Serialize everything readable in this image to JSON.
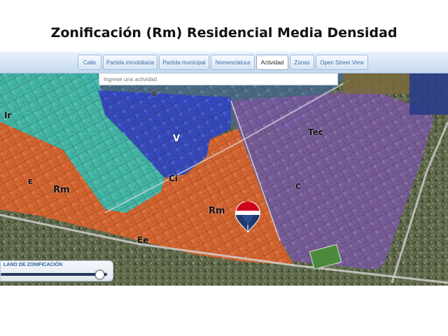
{
  "page": {
    "title": "Zonificación (Rm) Residencial Media Densidad"
  },
  "tabs": [
    {
      "label": "Calle",
      "active": false
    },
    {
      "label": "Partida inmobiliaria",
      "active": false
    },
    {
      "label": "Partida municipal",
      "active": false
    },
    {
      "label": "Nomenclatura",
      "active": false
    },
    {
      "label": "Actividad",
      "active": true
    },
    {
      "label": "Zonas",
      "active": false
    },
    {
      "label": "Open Street View",
      "active": false
    }
  ],
  "search": {
    "placeholder": "Ingrese una actividad",
    "value": ""
  },
  "map": {
    "zones": {
      "ir": "Ir",
      "b": "B",
      "v": "V",
      "tec": "Tec",
      "e": "E",
      "rm_west": "Rm",
      "ci": "Ci",
      "rm_center": "Rm",
      "c": "C",
      "ee": "Ee"
    },
    "zone_colors": {
      "ir": "#3fbfb0",
      "v": "#3246c8",
      "tec": "#7a5aa0",
      "rm": "#e0642c",
      "b": "#4a6a8a"
    },
    "marker_icon": "location-pin-flag-icon",
    "marker_colors": [
      "#d0021b",
      "#ffffff",
      "#1f3a6e"
    ]
  },
  "legend": {
    "title": "LANO DE ZONIFICACIÓN",
    "opacity_level": 0.93
  }
}
